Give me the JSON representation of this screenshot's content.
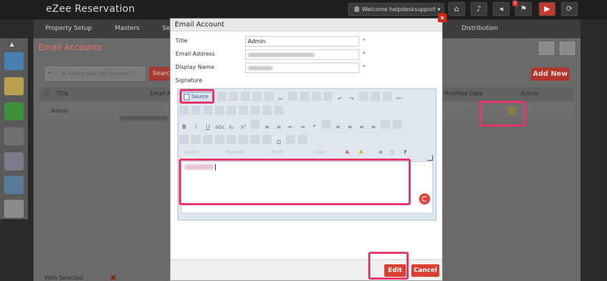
{
  "app": {
    "title": "eZee Reservation",
    "welcome": "Welcome helpdesksupport",
    "notification_count": "2"
  },
  "nav": {
    "items": [
      "Property Setup",
      "Masters",
      "Se",
      "Distribution"
    ]
  },
  "page": {
    "title": "Email Accounts",
    "search_placeholder": "To search type and hit enter...",
    "search_button": "Searc",
    "add_new": "Add New",
    "columns": [
      "Title",
      "Email A",
      "Modified Date",
      "Action"
    ],
    "row": {
      "title": "Admin",
      "modified_date": "--"
    },
    "with_selected": "With Selected"
  },
  "modal": {
    "title": "Email Account",
    "close": "x",
    "fields": {
      "title_label": "Title",
      "title_value": "Admin",
      "email_label": "Email Address",
      "display_label": "Display Name",
      "signature_label": "Signature",
      "required_mark": "*"
    },
    "editor": {
      "source_label": "Source",
      "styles": "Styles",
      "format": "Format",
      "font": "Font",
      "size": "Size"
    },
    "buttons": {
      "edit": "Edit",
      "cancel": "Cancel"
    }
  },
  "colors": {
    "accent": "#d9402f",
    "highlight": "#e8356a"
  }
}
